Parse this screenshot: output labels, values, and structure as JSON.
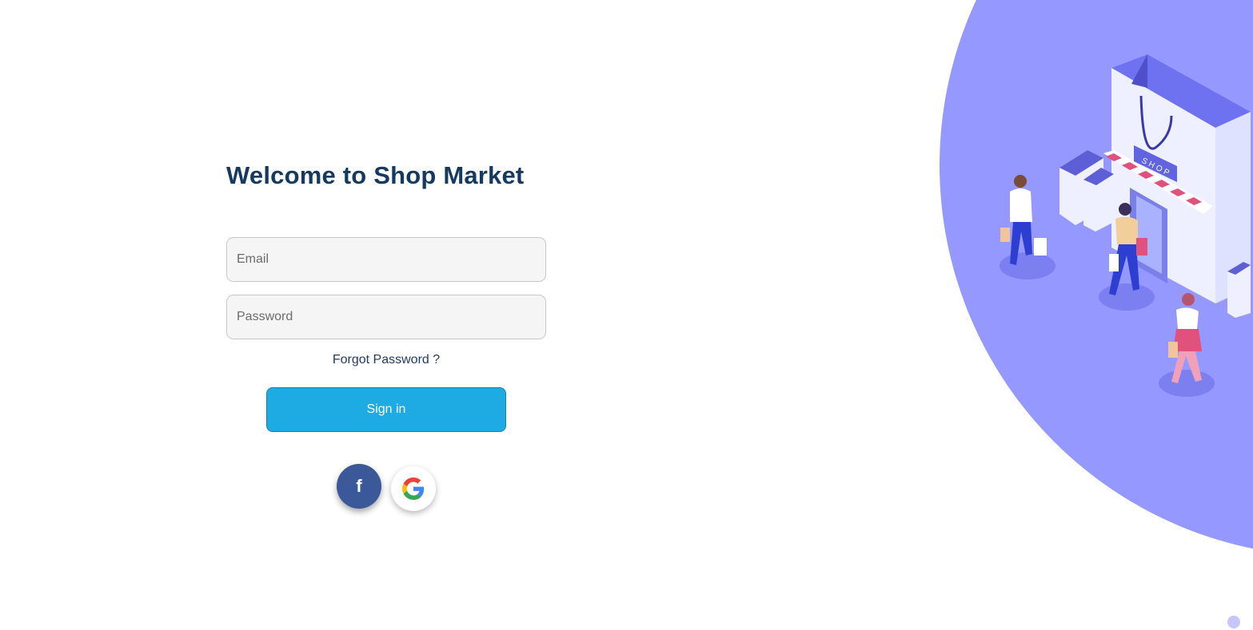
{
  "login": {
    "title": "Welcome to Shop Market",
    "email_placeholder": "Email",
    "password_placeholder": "Password",
    "forgot_password": "Forgot Password ?",
    "sign_in": "Sign in"
  },
  "social": {
    "facebook_glyph": "f",
    "facebook_icon": "facebook-icon",
    "google_icon": "google-icon"
  },
  "illustration": {
    "shop_sign": "SHOP"
  },
  "colors": {
    "title": "#163a5f",
    "accent": "#1eaae2",
    "facebook": "#3b5998",
    "illustration_bg": "#9599ff"
  }
}
